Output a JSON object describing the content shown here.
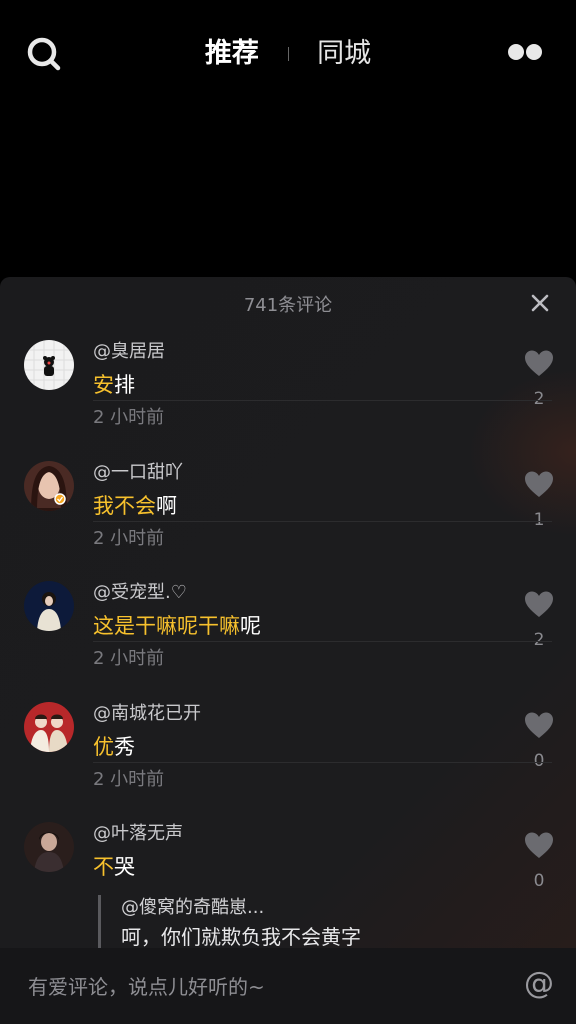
{
  "header": {
    "search_icon": "search-icon",
    "tab_recommend": "推荐",
    "tab_city": "同城",
    "more_icon": "two-dots-icon"
  },
  "comments_panel": {
    "title": "741条评论",
    "close_icon": "close-icon",
    "comments": [
      {
        "user": "@臭居居",
        "text_highlight": "安",
        "text_rest": "排",
        "time": "2 小时前",
        "likes": "2"
      },
      {
        "user": "@一口甜吖",
        "text_highlight": "我不会",
        "text_rest": "啊",
        "time": "2 小时前",
        "likes": "1"
      },
      {
        "user": "@受宠型.♡",
        "text_highlight": "这是干嘛呢干嘛",
        "text_rest": "呢",
        "time": "2 小时前",
        "likes": "2"
      },
      {
        "user": "@南城花已开",
        "text_highlight": "优",
        "text_rest": "秀",
        "time": "2 小时前",
        "likes": "0"
      },
      {
        "user": "@叶落无声",
        "text_highlight": "不",
        "text_rest": "哭",
        "time": "",
        "likes": "0"
      }
    ],
    "reply_preview": {
      "user": "@傻窝的奇酷崽...",
      "text": "呵，你们就欺负我不会黄字"
    }
  },
  "input": {
    "placeholder": "有爱评论，说点儿好听的~",
    "mention_label": "@"
  },
  "colors": {
    "highlight": "#f7c12d",
    "panel_bg": "#1c1c1e"
  }
}
